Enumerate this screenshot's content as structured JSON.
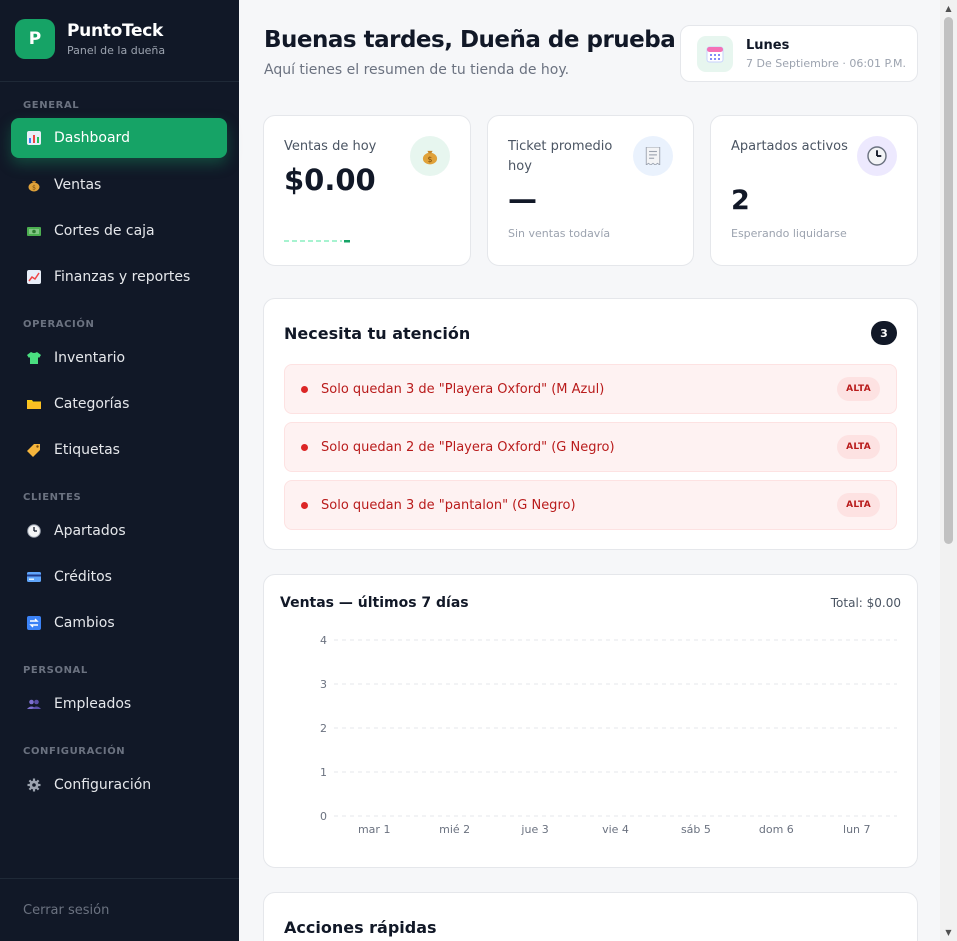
{
  "brand": {
    "logo_letter": "P",
    "name": "PuntoTeck",
    "subtitle": "Panel de la dueña"
  },
  "sidebar": {
    "sections": [
      {
        "label": "GENERAL",
        "items": [
          {
            "label": "Dashboard",
            "icon": "bar-chart-icon",
            "active": true
          },
          {
            "label": "Ventas",
            "icon": "money-bag-icon"
          },
          {
            "label": "Cortes de caja",
            "icon": "cash-icon"
          },
          {
            "label": "Finanzas y reportes",
            "icon": "trend-chart-icon"
          }
        ]
      },
      {
        "label": "OPERACIÓN",
        "items": [
          {
            "label": "Inventario",
            "icon": "shirt-icon"
          },
          {
            "label": "Categorías",
            "icon": "folder-icon"
          },
          {
            "label": "Etiquetas",
            "icon": "tag-icon"
          }
        ]
      },
      {
        "label": "CLIENTES",
        "items": [
          {
            "label": "Apartados",
            "icon": "clock-icon"
          },
          {
            "label": "Créditos",
            "icon": "credit-card-icon"
          },
          {
            "label": "Cambios",
            "icon": "exchange-icon"
          }
        ]
      },
      {
        "label": "PERSONAL",
        "items": [
          {
            "label": "Empleados",
            "icon": "people-icon"
          }
        ]
      },
      {
        "label": "CONFIGURACIÓN",
        "items": [
          {
            "label": "Configuración",
            "icon": "gear-icon"
          }
        ]
      }
    ],
    "logout_label": "Cerrar sesión"
  },
  "header": {
    "greeting": "Buenas tardes, Dueña de prueba 👋",
    "subtitle": "Aquí tienes el resumen de tu tienda de hoy.",
    "date": {
      "day": "Lunes",
      "full": "7 De Septiembre · 06:01 P.M."
    }
  },
  "stats": [
    {
      "label": "Ventas de hoy",
      "value": "$0.00",
      "icon": "money-bag-icon",
      "note": ""
    },
    {
      "label": "Ticket promedio hoy",
      "value": "—",
      "icon": "receipt-icon",
      "note": "Sin ventas todavía"
    },
    {
      "label": "Apartados activos",
      "value": "2",
      "icon": "clock-icon",
      "note": "Esperando liquidarse"
    }
  ],
  "attention": {
    "title": "Necesita tu atención",
    "count": "3",
    "alerts": [
      {
        "text": "Solo quedan 3 de \"Playera Oxford\" (M Azul)",
        "badge": "ALTA"
      },
      {
        "text": "Solo quedan 2 de \"Playera Oxford\" (G Negro)",
        "badge": "ALTA"
      },
      {
        "text": "Solo quedan 3 de \"pantalon\" (G Negro)",
        "badge": "ALTA"
      }
    ]
  },
  "sales_chart": {
    "title": "Ventas — últimos 7 días",
    "total": "Total: $0.00"
  },
  "chart_data": {
    "type": "line",
    "title": "Ventas — últimos 7 días",
    "categories": [
      "mar 1",
      "mié 2",
      "jue 3",
      "vie 4",
      "sáb 5",
      "dom 6",
      "lun 7"
    ],
    "values": [
      0,
      0,
      0,
      0,
      0,
      0,
      0
    ],
    "yticks": [
      "0",
      "1",
      "2",
      "3",
      "4"
    ],
    "ylim": [
      0,
      4
    ],
    "grid": true
  },
  "quick_actions": {
    "title": "Acciones rápidas"
  },
  "colors": {
    "accent": "#16a366",
    "sidebar_bg": "#111827",
    "alert": "#dc2626"
  }
}
